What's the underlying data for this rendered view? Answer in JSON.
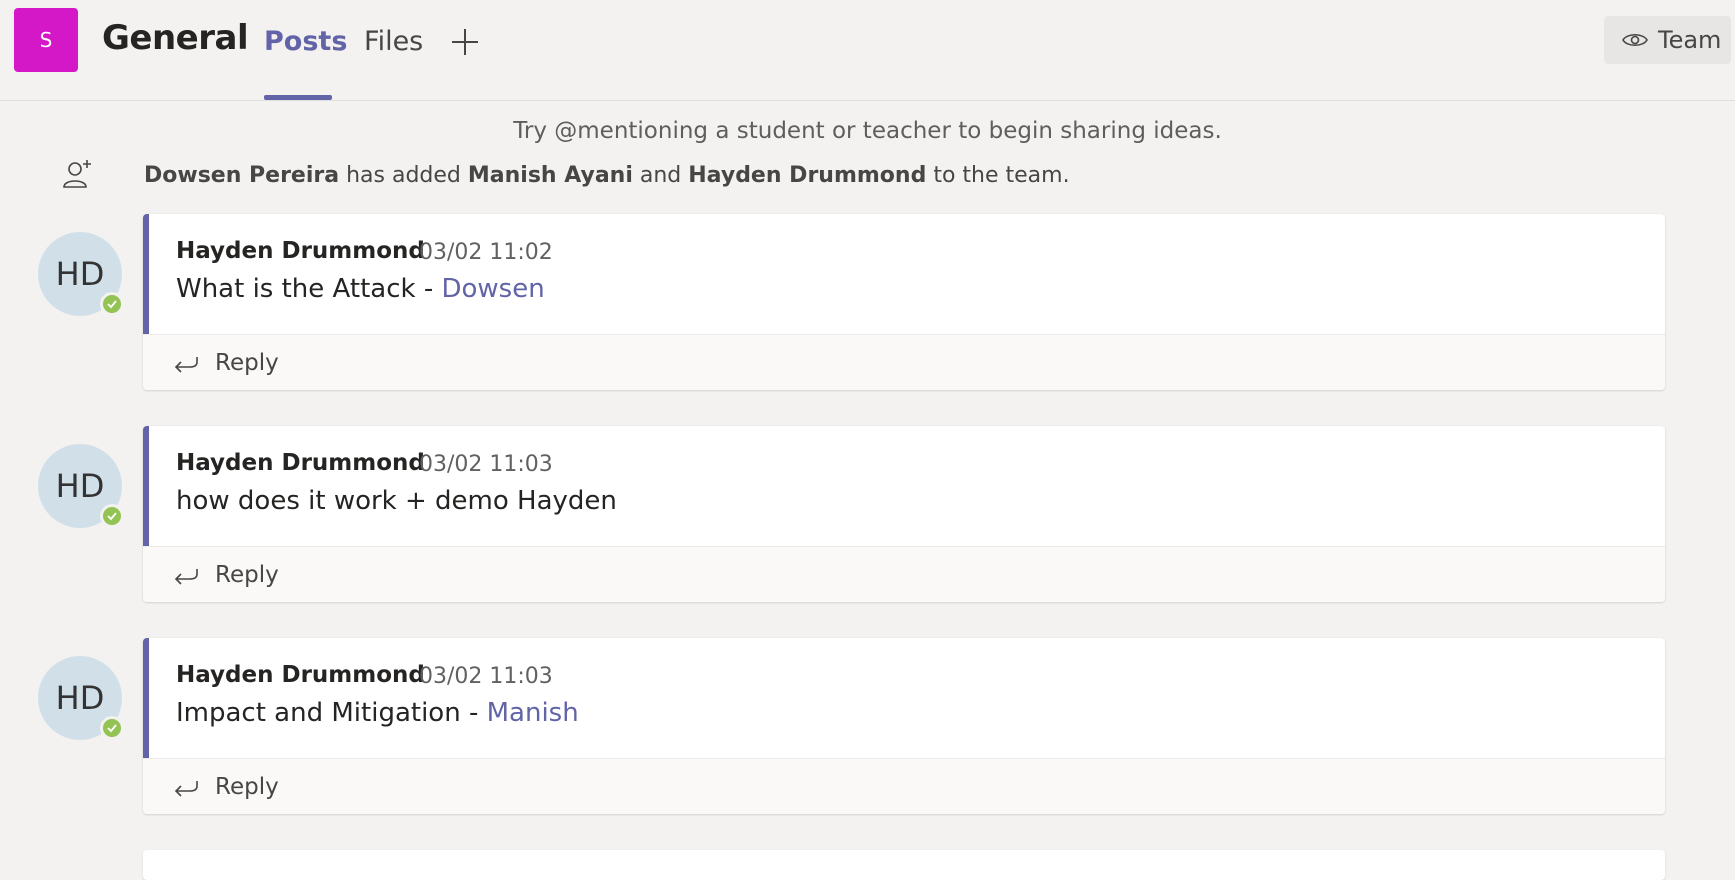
{
  "colors": {
    "brand": "#6264a7",
    "team_avatar": "#d417c7",
    "presence": "#92c353",
    "avatar_bg": "#d1e0e8"
  },
  "header": {
    "team_initial": "S",
    "channel_title": "General",
    "tabs": [
      {
        "label": "Posts",
        "active": true
      },
      {
        "label": "Files",
        "active": false
      }
    ],
    "add_tab_icon": "plus-icon",
    "team_button_label": "Team",
    "team_button_icon": "eye-icon"
  },
  "feed": {
    "hint": "Try @mentioning a student or teacher to begin sharing ideas.",
    "system_message": {
      "icon": "add-person-icon",
      "actor": "Dowsen Pereira",
      "text1": " has added ",
      "member1": "Manish Ayani",
      "text2": " and ",
      "member2": "Hayden Drummond",
      "text3": " to the team."
    },
    "posts": [
      {
        "avatar_initials": "HD",
        "author": "Hayden Drummond",
        "time": "03/02 11:02",
        "text": "What is the Attack - ",
        "mention": "Dowsen",
        "reply_label": "Reply"
      },
      {
        "avatar_initials": "HD",
        "author": "Hayden Drummond",
        "time": "03/02 11:03",
        "text": "how does it work + demo Hayden",
        "mention": "",
        "reply_label": "Reply"
      },
      {
        "avatar_initials": "HD",
        "author": "Hayden Drummond",
        "time": "03/02 11:03",
        "text": "Impact and Mitigation - ",
        "mention": "Manish",
        "reply_label": "Reply"
      }
    ]
  }
}
